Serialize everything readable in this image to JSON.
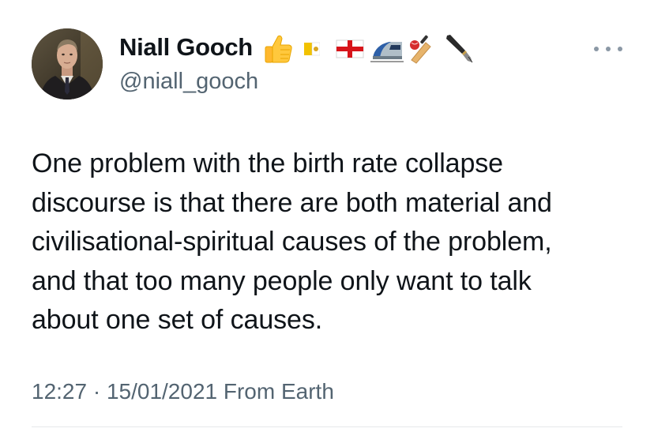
{
  "tweet": {
    "author": {
      "display_name": "Niall Gooch",
      "handle": "@niall_gooch",
      "badges": [
        "thumbs-up-emoji",
        "vatican-flag-emoji",
        "england-flag-emoji",
        "high-speed-train-emoji",
        "cricket-emoji",
        "fountain-pen-emoji"
      ]
    },
    "text_lines": [
      "One problem with the birth rate collapse",
      "discourse is that there are both material and",
      "civilisational-spiritual causes of the problem,",
      "and that too many people only want to talk",
      "about one set of causes."
    ],
    "timestamp": "12:27 · 15/01/2021",
    "source": "From Earth"
  },
  "colors": {
    "primary_text": "#0f1419",
    "secondary_text": "#536471",
    "divider": "#e6e9eb"
  }
}
